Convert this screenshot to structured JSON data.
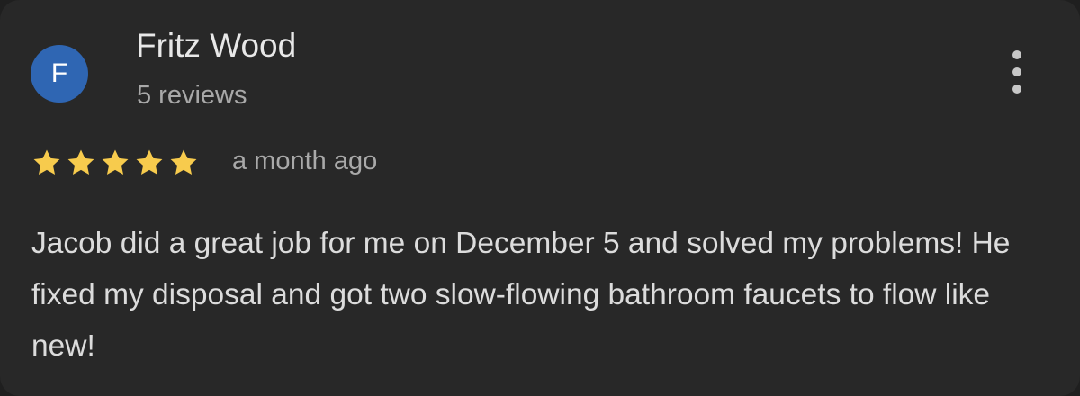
{
  "review": {
    "author": {
      "initial": "F",
      "name": "Fritz Wood",
      "review_count": "5 reviews",
      "avatar_color": "#2f66b3"
    },
    "rating": {
      "stars": 5,
      "max": 5,
      "star_color": "#f7cb4d"
    },
    "time_ago": "a month ago",
    "text": "Jacob did a great job for me on December 5 and solved my problems! He fixed my disposal and got two slow-flowing bathroom faucets to flow like new!",
    "more_icon": "more-vert-icon"
  }
}
